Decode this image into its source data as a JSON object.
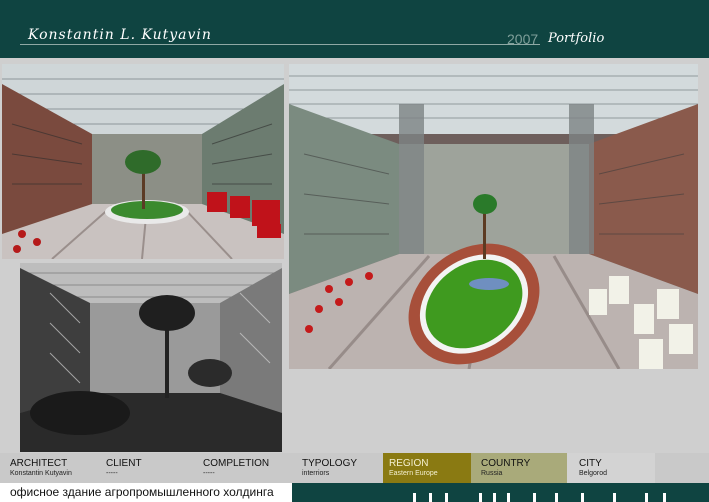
{
  "header": {
    "author": "Konstantin L. Kutyavin",
    "year": "2007",
    "portfolio": "Portfolio"
  },
  "images": [
    {
      "name": "atrium-render-top-left",
      "alt": "Atrium interior render with palm and red seating"
    },
    {
      "name": "atrium-render-bottom-left",
      "alt": "Black-and-white atrium render with palms"
    },
    {
      "name": "atrium-render-main",
      "alt": "Atrium interior render with oval green planter and palm"
    }
  ],
  "info": {
    "architect": {
      "label": "ARCHITECT",
      "value": "Konstantin Kutyavin"
    },
    "client": {
      "label": "CLIENT",
      "value": "-----"
    },
    "completion": {
      "label": "COMPLETION",
      "value": "-----"
    },
    "typology": {
      "label": "TYPOLOGY",
      "value": "interriors"
    },
    "region": {
      "label": "REGION",
      "value": "Eastern Europe"
    },
    "country": {
      "label": "COUNTRY",
      "value": "Russia"
    },
    "city": {
      "label": "CITY",
      "value": "Belgorod"
    }
  },
  "colors": {
    "header_bg": "#0f4441",
    "region_bg": "#8a7a12",
    "country_bg": "#a9aa7a",
    "city_bg": "#d3d3d3"
  },
  "caption": "офисное здание агропромышленного холдинга"
}
